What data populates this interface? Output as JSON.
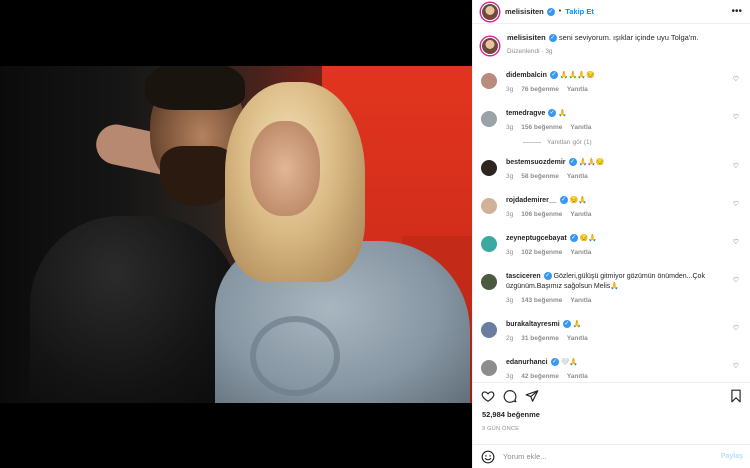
{
  "header": {
    "username": "melisisiten",
    "follow_label": "Takip Et",
    "separator": "•",
    "more": "•••"
  },
  "caption": {
    "username": "melisisiten",
    "text": "seni seviyorum. ışıklar içinde uyu Tolga'm.",
    "edited": "Düzenlendi",
    "age": "3g"
  },
  "comments": [
    {
      "username": "didembalcin",
      "text": "🙏🙏🙏😔",
      "age": "3g",
      "likes": "76 beğenme",
      "reply": "Yanıtla",
      "avatar_color": "#b98b7a"
    },
    {
      "username": "temedragve",
      "text": "🙏",
      "age": "3g",
      "likes": "156 beğenme",
      "reply": "Yanıtla",
      "avatar_color": "#9aa3a8",
      "view_replies": "Yanıtları gör (1)"
    },
    {
      "username": "bestemsuozdemir",
      "text": "🙏🙏😔",
      "age": "3g",
      "likes": "58 beğenme",
      "reply": "Yanıtla",
      "avatar_color": "#2d2620"
    },
    {
      "username": "rojdademirer__",
      "text": "😔🙏",
      "age": "3g",
      "likes": "106 beğenme",
      "reply": "Yanıtla",
      "avatar_color": "#d2b19a"
    },
    {
      "username": "zeyneptugcebayat",
      "text": "😔🙏",
      "age": "3g",
      "likes": "102 beğenme",
      "reply": "Yanıtla",
      "avatar_color": "#3aa9a0"
    },
    {
      "username": "tasciceren",
      "text": "Gözleri,gülüşü gitmiyor gözümün önümden...Çok üzgünüm.Başımız sağolsun Melis🙏",
      "age": "3g",
      "likes": "143 beğenme",
      "reply": "Yanıtla",
      "avatar_color": "#4a5a3f"
    },
    {
      "username": "burakaltayresmi",
      "text": "🙏",
      "age": "2g",
      "likes": "31 beğenme",
      "reply": "Yanıtla",
      "avatar_color": "#6a7ea0"
    },
    {
      "username": "edanurhanci",
      "text": "🤍🙏",
      "age": "3g",
      "likes": "42 beğenme",
      "reply": "Yanıtla",
      "avatar_color": "#8c8c8c"
    }
  ],
  "likes_count": "52,984 beğenme",
  "posted": "3 GÜN ÖNCE",
  "comment_input": {
    "placeholder": "Yorum ekle...",
    "post_label": "Paylaş"
  },
  "colors": {
    "accent": "#0095f6",
    "verified": "#3897f0",
    "muted": "#8e8e8e"
  },
  "icons": [
    "heart-icon",
    "comment-icon",
    "share-icon",
    "bookmark-icon",
    "emoji-icon",
    "more-icon"
  ]
}
